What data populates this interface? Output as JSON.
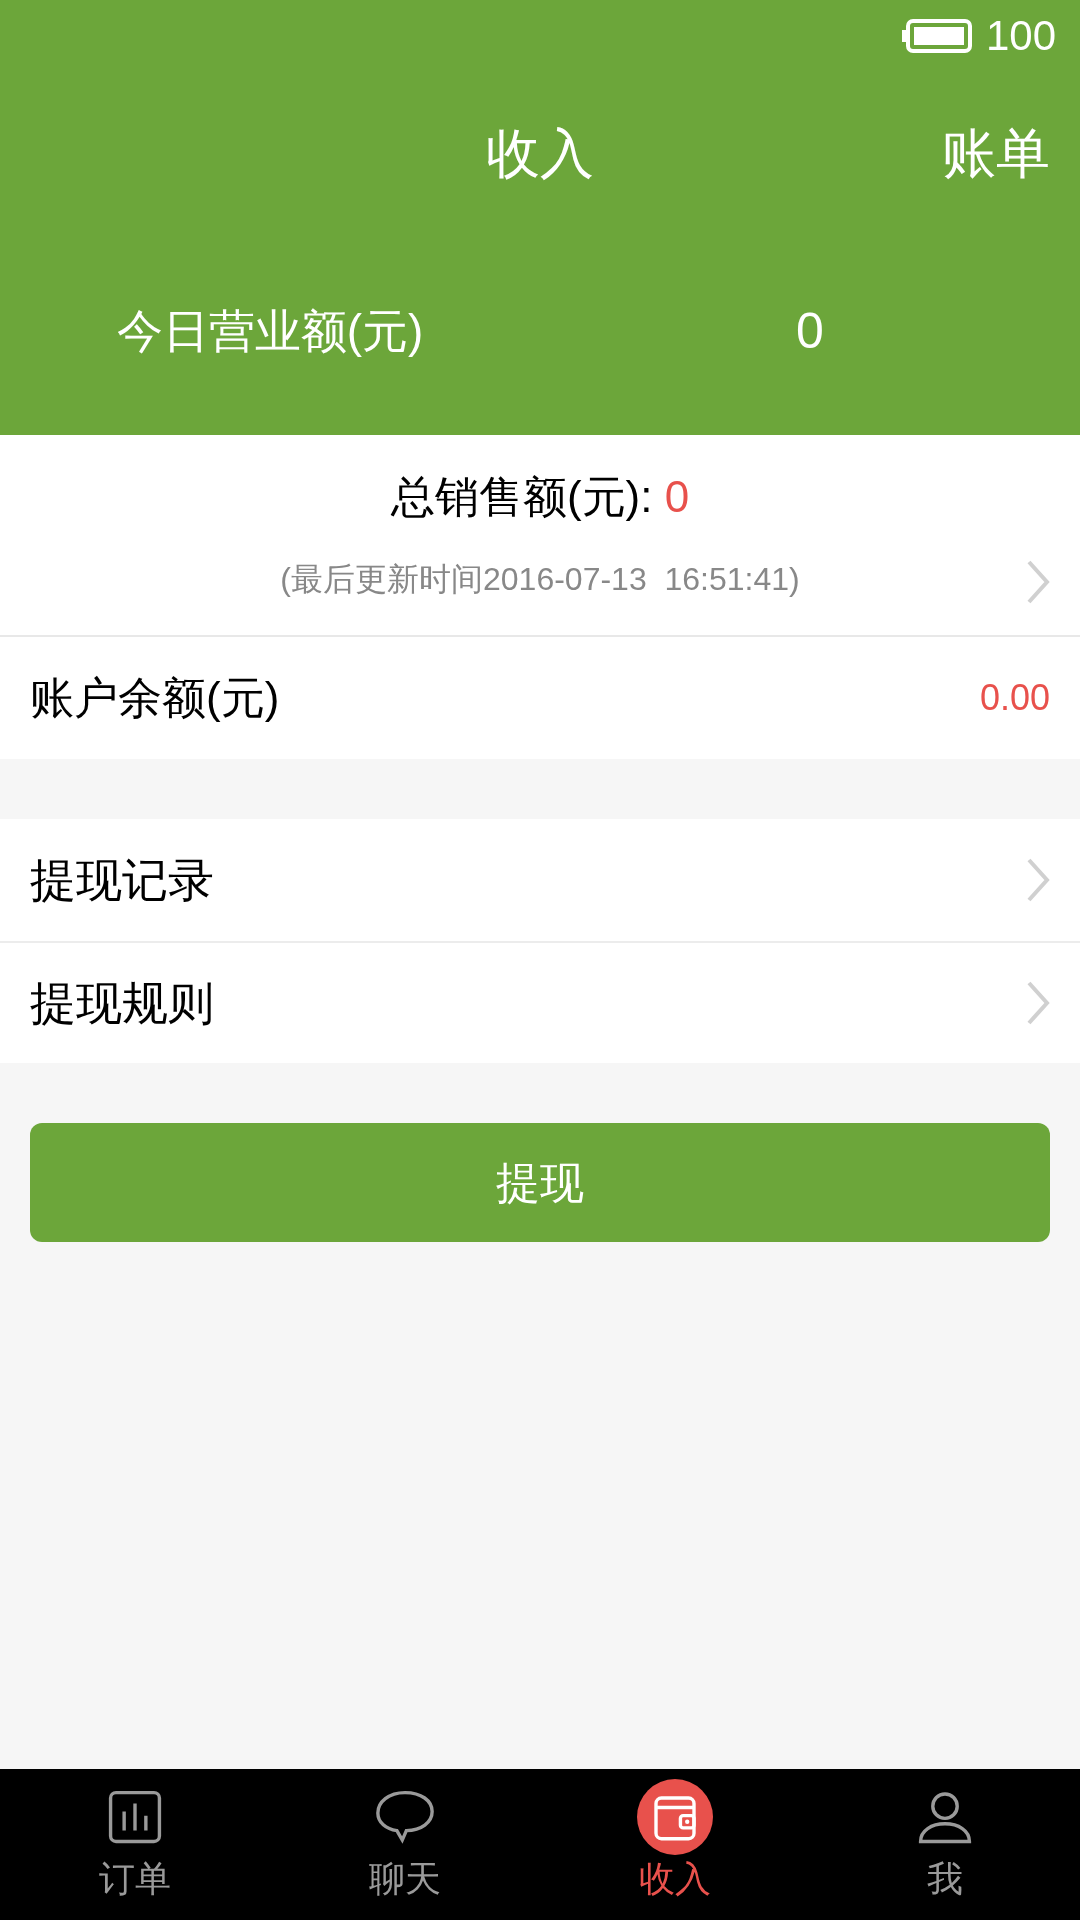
{
  "status_bar": {
    "battery_text": "100"
  },
  "header": {
    "title": "收入",
    "action": "账单"
  },
  "today": {
    "label": "今日营业额(元)",
    "value": "0"
  },
  "total": {
    "label": "总销售额(元): ",
    "value": "0",
    "updated": "(最后更新时间2016-07-13  16:51:41)"
  },
  "balance": {
    "label": "账户余额(元)",
    "value": "0.00"
  },
  "menu": [
    {
      "label": "提现记录"
    },
    {
      "label": "提现规则"
    }
  ],
  "withdraw_button": "提现",
  "tabs": [
    {
      "label": "订单",
      "selected": false
    },
    {
      "label": "聊天",
      "selected": false
    },
    {
      "label": "收入",
      "selected": true
    },
    {
      "label": "我",
      "selected": false
    }
  ]
}
